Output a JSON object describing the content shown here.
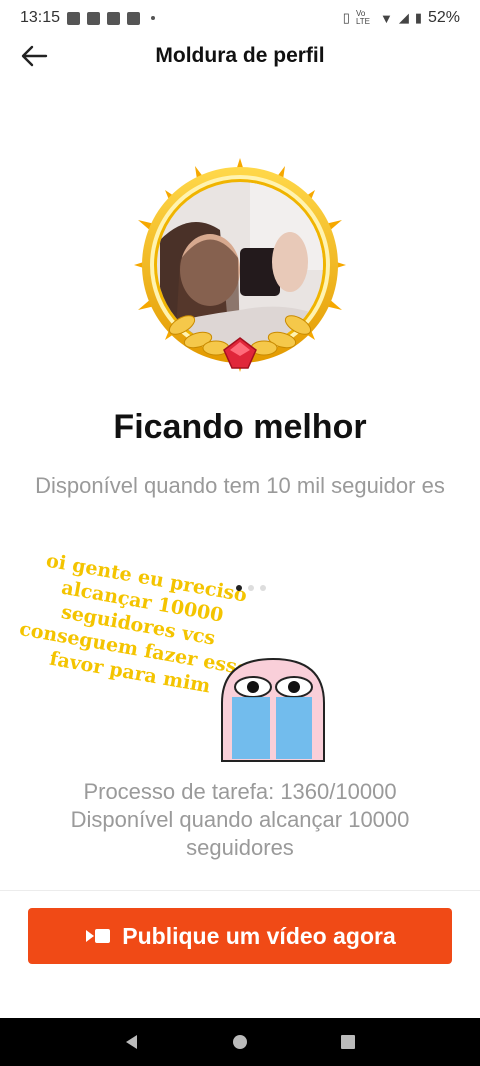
{
  "status": {
    "time": "13:15",
    "battery": "52%",
    "volte": "Vo LTE"
  },
  "app_bar": {
    "title": "Moldura de perfil"
  },
  "frame": {
    "name": "Ficando melhor",
    "availability": "Disponível quando tem 10 mil seguidor es"
  },
  "sticker": {
    "text": "oi gente eu preciso alcançar 10000 seguidores vcs conseguem fazer esse favor para mim"
  },
  "task": {
    "progress": "Processo de tarefa: 1360/10000",
    "condition": "Disponível quando alcançar 10000 seguidores"
  },
  "actions": {
    "publish_label": "Publique um vídeo agora"
  },
  "colors": {
    "accent": "#f04a16",
    "gold": "#f2b400",
    "sticker_text": "#f4c400"
  }
}
